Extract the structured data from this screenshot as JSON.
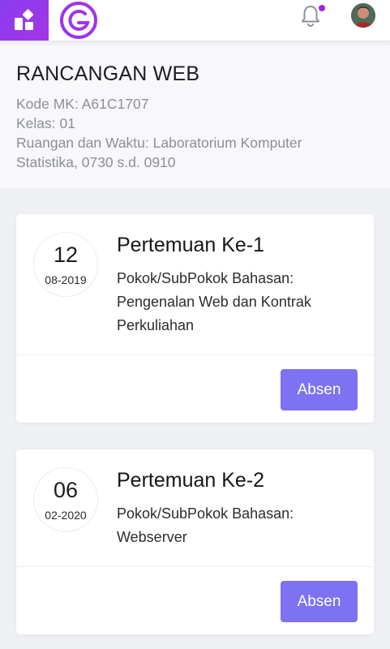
{
  "course": {
    "title": "RANCANGAN WEB",
    "kode": "Kode MK: A61C1707",
    "kelas": "Kelas: 01",
    "ruangan": "Ruangan dan Waktu: Laboratorium Komputer Statistika, 0730 s.d. 0910"
  },
  "meetings": [
    {
      "day": "12",
      "month": "08-2019",
      "title": "Pertemuan Ke-1",
      "desc": "Pokok/SubPokok Bahasan: Pengenalan Web dan Kontrak Perkuliahan",
      "button": "Absen"
    },
    {
      "day": "06",
      "month": "02-2020",
      "title": "Pertemuan Ke-2",
      "desc": "Pokok/SubPokok Bahasan: Webserver",
      "button": "Absen"
    }
  ],
  "colors": {
    "accent_purple": "#8a3cf0",
    "button": "#7c72f2",
    "notification_dot": "#a325e0"
  },
  "icons": {
    "menu": "dashboard-grid-icon",
    "logo": "g-logo-icon",
    "notifications": "bell-icon",
    "profile": "avatar"
  }
}
